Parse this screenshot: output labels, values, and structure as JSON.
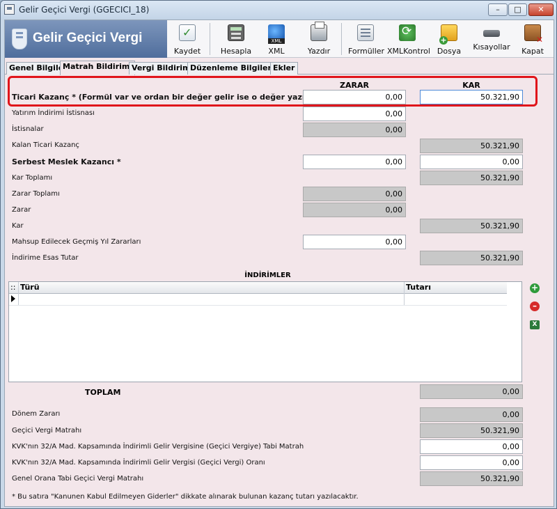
{
  "window": {
    "title": "Gelir Geçici Vergi (GGECICI_18)",
    "min_glyph": "–",
    "max_glyph": "□",
    "close_glyph": "✕"
  },
  "brand": {
    "title": "Gelir Geçici Vergi"
  },
  "toolbar": {
    "kaydet": "Kaydet",
    "hesapla": "Hesapla",
    "xml": "XML",
    "yazdir": "Yazdır",
    "formuller": "Formüller",
    "xmlkontrol": "XMLKontrol",
    "dosya": "Dosya",
    "kisayollar": "Kısayollar",
    "kapat": "Kapat"
  },
  "tabs": {
    "genel": "Genel Bilgiler",
    "matrah": "Matrah Bildirimi",
    "vergi": "Vergi Bildirimi",
    "duzenleme": "Düzenleme Bilgileri",
    "ekler": "Ekler"
  },
  "columns": {
    "zarar": "ZARAR",
    "kar": "KAR"
  },
  "rows": {
    "ticari_kazanc": {
      "label": "Ticari Kazanç * (Formül var ve ordan bir değer gelir ise o değer yazılır)",
      "zarar": "0,00",
      "kar": "50.321,90"
    },
    "yatirim_indirimi": {
      "label": "Yatırım İndirimi İstisnası",
      "zarar": "0,00"
    },
    "istisnalar": {
      "label": "İstisnalar",
      "zarar": "0,00"
    },
    "kalan_ticari": {
      "label": "Kalan Ticari Kazanç",
      "kar": "50.321,90"
    },
    "serbest_meslek": {
      "label": "Serbest Meslek Kazancı *",
      "zarar": "0,00",
      "kar": "0,00"
    },
    "kar_toplami": {
      "label": "Kar Toplamı",
      "kar": "50.321,90"
    },
    "zarar_toplami": {
      "label": "Zarar Toplamı",
      "zarar": "0,00"
    },
    "zarar": {
      "label": "Zarar",
      "zarar": "0,00"
    },
    "kar": {
      "label": "Kar",
      "kar": "50.321,90"
    },
    "mahsup": {
      "label": "Mahsup Edilecek Geçmiş Yıl Zararları",
      "zarar": "0,00"
    },
    "indirime_esas": {
      "label": "İndirime Esas Tutar",
      "kar": "50.321,90"
    }
  },
  "indirimler": {
    "title": "İNDİRİMLER",
    "col_handle": "::",
    "col_turu": "Türü",
    "col_tutari": "Tutarı",
    "toplam_label": "TOPLAM",
    "toplam_value": "0,00",
    "add_glyph": "+",
    "remove_glyph": "–",
    "excel_glyph": "X"
  },
  "bottom": {
    "donem_zarari": {
      "label": "Dönem Zararı",
      "value": "0,00"
    },
    "gecici_matrah": {
      "label": "Geçici Vergi Matrahı",
      "value": "50.321,90"
    },
    "kvk_matrah": {
      "label": "KVK'nın 32/A Mad. Kapsamında İndirimli Gelir Vergisine (Geçici Vergiye) Tabi Matrah",
      "value": "0,00"
    },
    "kvk_oran": {
      "label": "KVK'nın 32/A Mad. Kapsamında İndirimli Gelir Vergisi (Geçici Vergi) Oranı",
      "value": "0,00"
    },
    "genel_orana": {
      "label": "Genel Orana Tabi Geçici Vergi Matrahı",
      "value": "50.321,90"
    }
  },
  "footnote": "* Bu satıra \"Kanunen Kabul Edilmeyen Giderler\" dikkate alınarak bulunan kazanç tutarı yazılacaktır."
}
